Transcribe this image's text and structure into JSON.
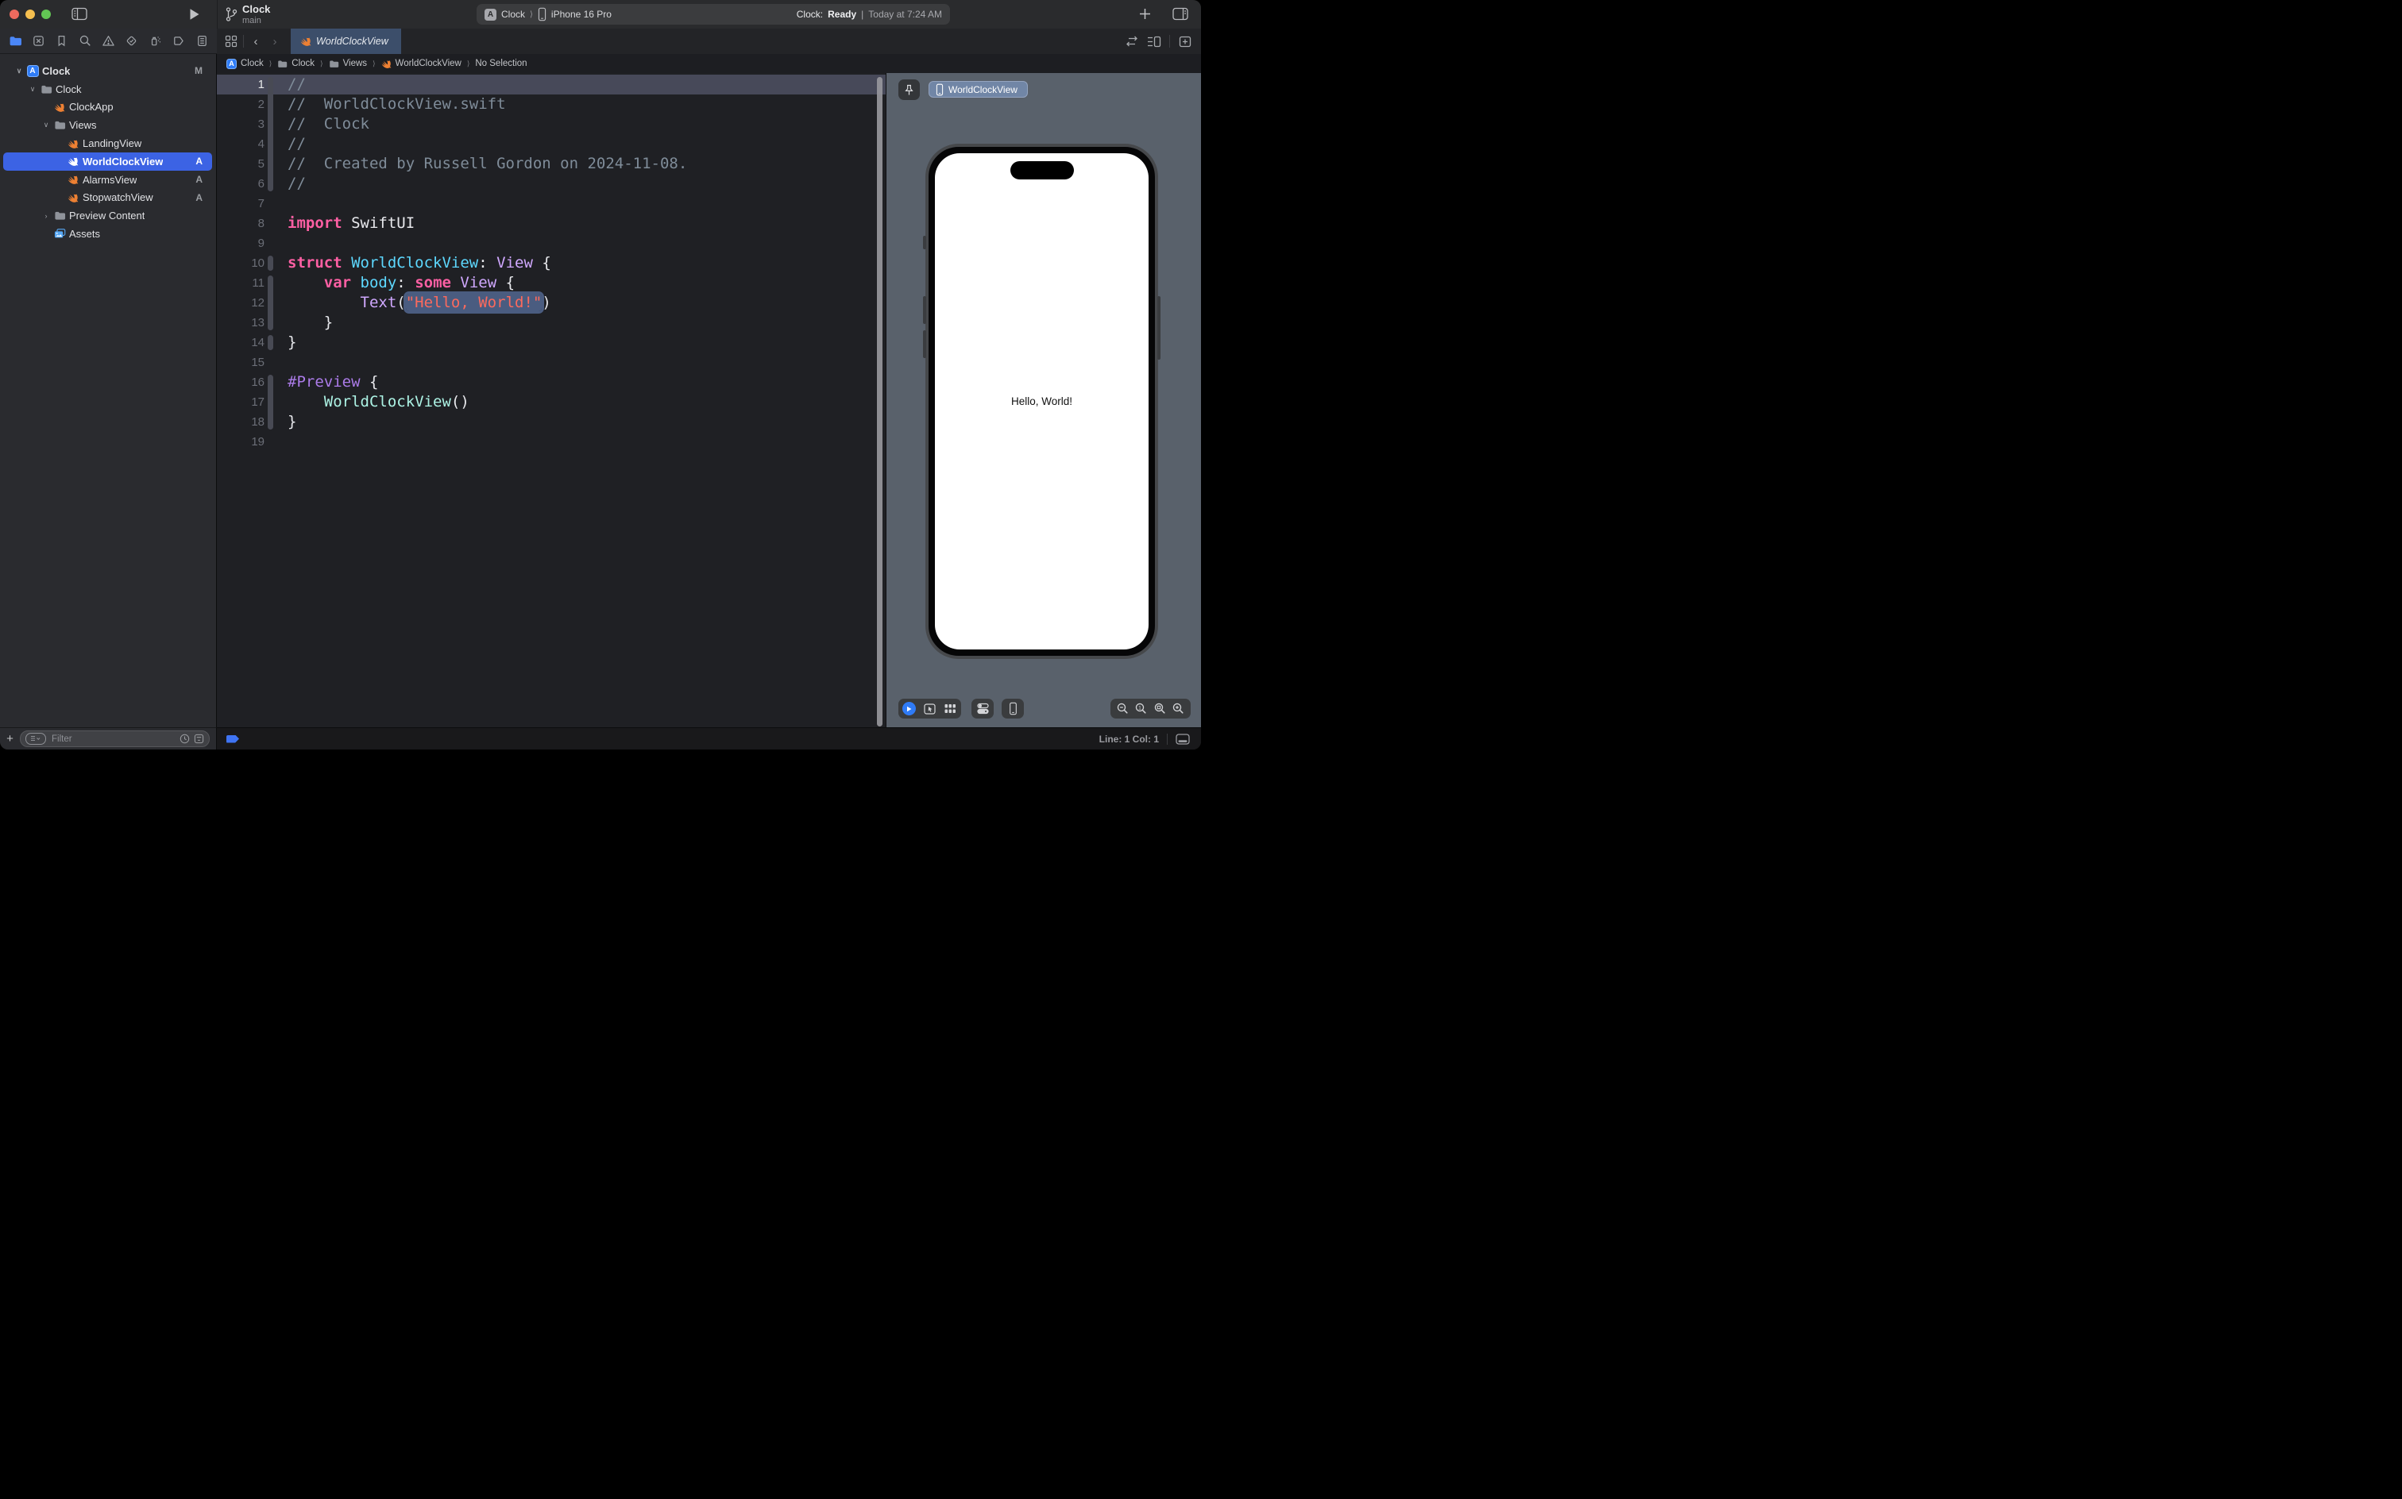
{
  "toolbar": {
    "scheme_name": "Clock",
    "scheme_branch": "main",
    "destination_app": "Clock",
    "destination_chevron": "⟩",
    "destination_device": "iPhone 16 Pro",
    "status_app": "Clock:",
    "status_state": "Ready",
    "status_sep": "|",
    "status_time": "Today at 7:24 AM"
  },
  "navigator_tabs": [
    "project",
    "source-control-changes",
    "bookmarks",
    "find",
    "issues",
    "tests",
    "debug",
    "breakpoints",
    "reports"
  ],
  "tabbar": {
    "tab_label": "WorldClockView"
  },
  "breadcrumb": {
    "chevron": "⟩",
    "items": [
      {
        "label": "Clock",
        "icon": "app-icon"
      },
      {
        "label": "Clock",
        "icon": "folder-icon"
      },
      {
        "label": "Views",
        "icon": "folder-icon"
      },
      {
        "label": "WorldClockView",
        "icon": "swift-icon"
      },
      {
        "label": "No Selection",
        "icon": null
      }
    ]
  },
  "sidebar": {
    "filter_placeholder": "Filter",
    "tree": [
      {
        "label": "Clock",
        "type": "project",
        "level": 0,
        "chevron": "down",
        "badge": "M",
        "bold": true
      },
      {
        "label": "Clock",
        "type": "folder",
        "level": 1,
        "chevron": "down"
      },
      {
        "label": "ClockApp",
        "type": "swift",
        "level": 2
      },
      {
        "label": "Views",
        "type": "folder",
        "level": 2,
        "chevron": "down"
      },
      {
        "label": "LandingView",
        "type": "swift",
        "level": 3
      },
      {
        "label": "WorldClockView",
        "type": "swift",
        "level": 3,
        "selected": true,
        "badge": "A"
      },
      {
        "label": "AlarmsView",
        "type": "swift",
        "level": 3,
        "badge": "A"
      },
      {
        "label": "StopwatchView",
        "type": "swift",
        "level": 3,
        "badge": "A"
      },
      {
        "label": "Preview Content",
        "type": "folder",
        "level": 2,
        "chevron": "right"
      },
      {
        "label": "Assets",
        "type": "assets",
        "level": 2
      }
    ]
  },
  "editor": {
    "current_line": 1,
    "lines": [
      {
        "n": 1,
        "tokens": [
          {
            "t": "//",
            "c": "comment"
          }
        ]
      },
      {
        "n": 2,
        "tokens": [
          {
            "t": "//  WorldClockView.swift",
            "c": "comment"
          }
        ]
      },
      {
        "n": 3,
        "tokens": [
          {
            "t": "//  Clock",
            "c": "comment"
          }
        ]
      },
      {
        "n": 4,
        "tokens": [
          {
            "t": "//",
            "c": "comment"
          }
        ]
      },
      {
        "n": 5,
        "tokens": [
          {
            "t": "//  Created by Russell Gordon on 2024-11-08.",
            "c": "comment"
          }
        ]
      },
      {
        "n": 6,
        "tokens": [
          {
            "t": "//",
            "c": "comment"
          }
        ]
      },
      {
        "n": 7,
        "tokens": []
      },
      {
        "n": 8,
        "tokens": [
          {
            "t": "import",
            "c": "keyword"
          },
          {
            "t": " SwiftUI",
            "c": "plain"
          }
        ]
      },
      {
        "n": 9,
        "tokens": []
      },
      {
        "n": 10,
        "tokens": [
          {
            "t": "struct ",
            "c": "keyword"
          },
          {
            "t": "WorldClockView",
            "c": "decl"
          },
          {
            "t": ": ",
            "c": "plain"
          },
          {
            "t": "View",
            "c": "type"
          },
          {
            "t": " {",
            "c": "plain"
          }
        ]
      },
      {
        "n": 11,
        "tokens": [
          {
            "t": "    ",
            "c": "plain"
          },
          {
            "t": "var ",
            "c": "keyword"
          },
          {
            "t": "body",
            "c": "decl"
          },
          {
            "t": ": ",
            "c": "plain"
          },
          {
            "t": "some ",
            "c": "keyword"
          },
          {
            "t": "View",
            "c": "type"
          },
          {
            "t": " {",
            "c": "plain"
          }
        ]
      },
      {
        "n": 12,
        "tokens": [
          {
            "t": "        ",
            "c": "plain"
          },
          {
            "t": "Text",
            "c": "type"
          },
          {
            "t": "(",
            "c": "plain"
          },
          {
            "t": "\"Hello, World!\"",
            "c": "string",
            "sel": true
          },
          {
            "t": ")",
            "c": "plain"
          }
        ]
      },
      {
        "n": 13,
        "tokens": [
          {
            "t": "    }",
            "c": "plain"
          }
        ]
      },
      {
        "n": 14,
        "tokens": [
          {
            "t": "}",
            "c": "plain"
          }
        ]
      },
      {
        "n": 15,
        "tokens": []
      },
      {
        "n": 16,
        "tokens": [
          {
            "t": "#Preview",
            "c": "macro"
          },
          {
            "t": " {",
            "c": "plain"
          }
        ]
      },
      {
        "n": 17,
        "tokens": [
          {
            "t": "    ",
            "c": "plain"
          },
          {
            "t": "WorldClockView",
            "c": "mint"
          },
          {
            "t": "()",
            "c": "plain"
          }
        ]
      },
      {
        "n": 18,
        "tokens": [
          {
            "t": "}",
            "c": "plain"
          }
        ]
      },
      {
        "n": 19,
        "tokens": []
      }
    ],
    "ribbon_segments": [
      [
        1,
        6
      ],
      [
        10,
        10
      ],
      [
        11,
        13
      ],
      [
        14,
        14
      ],
      [
        16,
        18
      ]
    ]
  },
  "preview": {
    "pill_label": "WorldClockView",
    "device_text": "Hello, World!"
  },
  "statusbar": {
    "line_col": "Line: 1  Col: 1"
  },
  "colors": {
    "accent_blue": "#3c63e4",
    "run_play_blue": "#2f7bf6",
    "tab_selected": "#3c4e6a",
    "preview_canvas": "#59616b",
    "editor_bg": "#1f2024",
    "current_line": "#474959",
    "selection_highlight": "#4a5c80",
    "swift_orange": "#ed8033",
    "syntax": {
      "comment": "#7f8c99",
      "keyword": "#fc5fa3",
      "declaration": "#5dd8ff",
      "type": "#d0a8ff",
      "string": "#fc6a5d",
      "macro": "#ab7be8",
      "project_class": "#acf2e4",
      "plain": "#e8e9ed"
    }
  }
}
